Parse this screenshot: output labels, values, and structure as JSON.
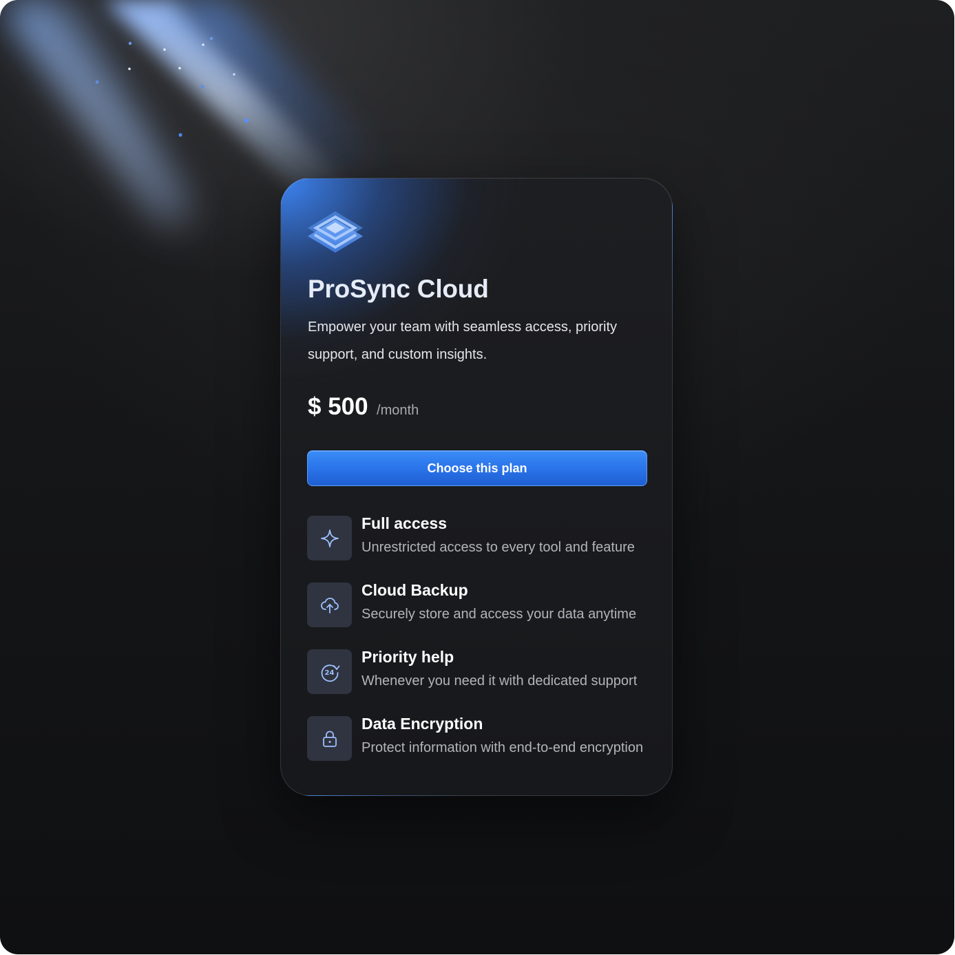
{
  "plan": {
    "name": "ProSync Cloud",
    "description": "Empower your team with seamless access, priority support, and custom insights.",
    "price": "$ 500",
    "period": "/month",
    "cta_label": "Choose this plan"
  },
  "features": [
    {
      "title": "Full access",
      "text": "Unrestricted access to every tool and feature",
      "icon": "sparkle-icon"
    },
    {
      "title": "Cloud Backup",
      "text": "Securely store and access your data anytime",
      "icon": "cloud-upload-icon"
    },
    {
      "title": "Priority help",
      "text": "Whenever you need it with dedicated support",
      "icon": "support-24-icon"
    },
    {
      "title": "Data Encryption",
      "text": "Protect information with end-to-end encryption",
      "icon": "lock-icon"
    }
  ],
  "colors": {
    "accent": "#2a74ea",
    "icon_tile": "#2f3440",
    "icon_stroke": "#9fc0ff",
    "background": "#151618"
  }
}
